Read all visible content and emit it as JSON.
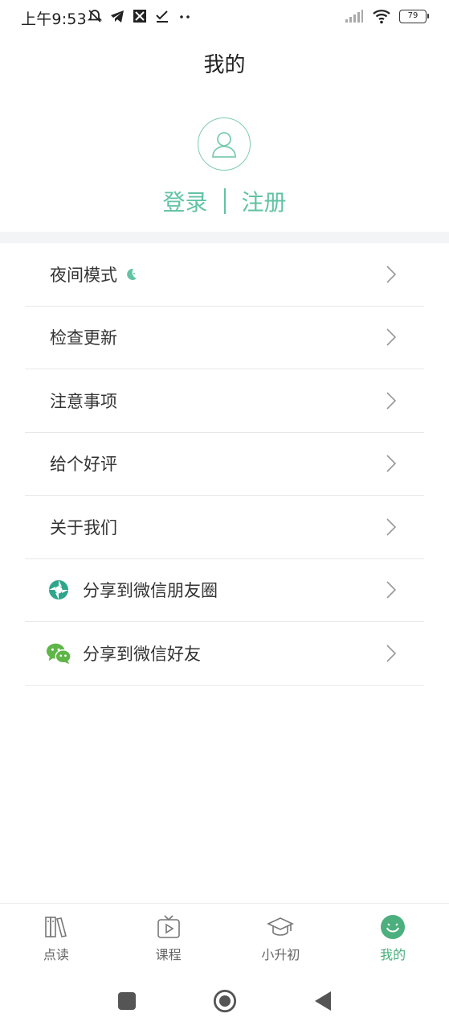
{
  "status_bar": {
    "time": "上午9:53",
    "battery": "79"
  },
  "header": {
    "title": "我的"
  },
  "profile": {
    "login_label": "登录",
    "register_label": "注册"
  },
  "menu": {
    "items": [
      {
        "label": "夜间模式",
        "icon": "moon-icon"
      },
      {
        "label": "检查更新"
      },
      {
        "label": "注意事项"
      },
      {
        "label": "给个好评"
      },
      {
        "label": "关于我们"
      },
      {
        "label": "分享到微信朋友圈",
        "icon": "wechat-moments-icon"
      },
      {
        "label": "分享到微信好友",
        "icon": "wechat-icon"
      }
    ]
  },
  "bottom_nav": {
    "items": [
      {
        "label": "点读",
        "icon": "books-icon"
      },
      {
        "label": "课程",
        "icon": "tv-play-icon"
      },
      {
        "label": "小升初",
        "icon": "graduation-cap-icon"
      },
      {
        "label": "我的",
        "icon": "smile-face-icon",
        "active": true
      }
    ]
  },
  "colors": {
    "accent": "#62c3a4",
    "active_nav": "#4caf7e",
    "divider": "#e8e8e8"
  }
}
